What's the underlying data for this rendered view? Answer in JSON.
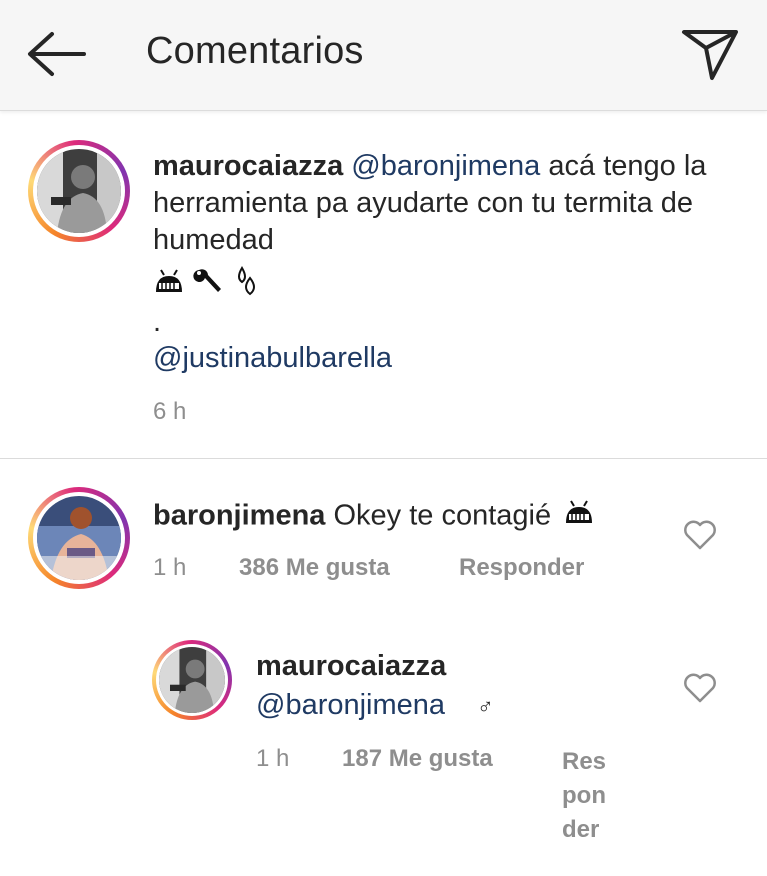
{
  "header": {
    "title": "Comentarios"
  },
  "caption": {
    "username": "maurocaiazza",
    "mention": "@baronjimena",
    "text": "acá tengo la herramienta pa ayudarte con tu termita de humedad",
    "dot": ".",
    "mention2": "@justinabulbarella",
    "time": "6 h"
  },
  "comment1": {
    "username": "baronjimena",
    "text": "Okey te contagié",
    "time": "1 h",
    "likes": "386 Me gusta",
    "reply": "Responder"
  },
  "comment2": {
    "username": "maurocaiazza",
    "mention": "@baronjimena",
    "symbol": "♂",
    "time": "1 h",
    "likes": "187 Me gusta",
    "reply1": "Res",
    "reply2": "pon",
    "reply3": "der"
  },
  "colors": {
    "mention": "#1f3a63",
    "meta": "#8e8e8e",
    "header_bg": "#f6f6f6"
  }
}
